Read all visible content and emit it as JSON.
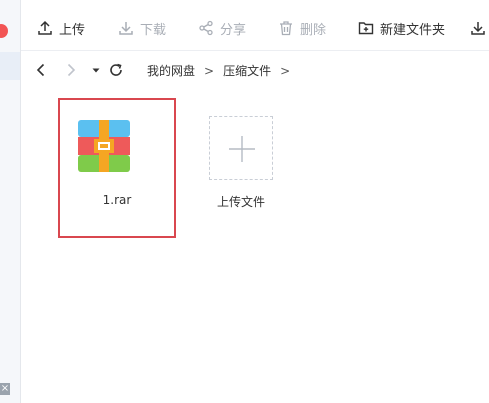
{
  "toolbar": {
    "upload_label": "上传",
    "download_label": "下载",
    "share_label": "分享",
    "delete_label": "删除",
    "new_folder_label": "新建文件夹"
  },
  "breadcrumb": {
    "root": "我的网盘",
    "separator": ">",
    "current": "压缩文件"
  },
  "files": [
    {
      "name": "1.rar",
      "icon": "rar-archive-icon",
      "selected": true
    }
  ],
  "upload_tile": {
    "label": "上传文件"
  },
  "colors": {
    "selection_border": "#d9474f",
    "rar_blue": "#5bc0f0",
    "rar_red": "#ee5a5a",
    "rar_green": "#7fcb4a",
    "rar_band": "#f5a623"
  }
}
